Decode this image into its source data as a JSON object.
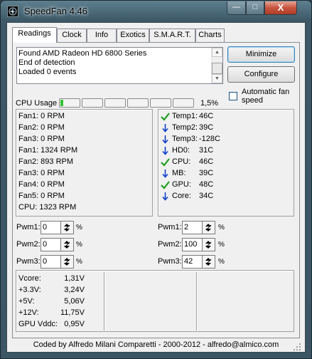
{
  "window": {
    "title": "SpeedFan 4.46",
    "caption_buttons": {
      "minimize": "—",
      "maximize": "□",
      "close": "X"
    }
  },
  "tabs": [
    {
      "label": "Readings",
      "active": true
    },
    {
      "label": "Clock",
      "active": false
    },
    {
      "label": "Info",
      "active": false
    },
    {
      "label": "Exotics",
      "active": false
    },
    {
      "label": "S.M.A.R.T.",
      "active": false
    },
    {
      "label": "Charts",
      "active": false
    }
  ],
  "log": {
    "lines": [
      "Found AMD Radeon HD 6800 Series",
      "End of detection",
      "Loaded 0 events"
    ]
  },
  "buttons": {
    "minimize": "Minimize",
    "configure": "Configure"
  },
  "auto_fan_speed": {
    "label_line1": "Automatic fan",
    "label_line2": "speed",
    "checked": false
  },
  "cpu_usage": {
    "label": "CPU Usage",
    "percent_text": "1,5%",
    "segments": [
      0.15,
      0,
      0,
      0,
      0,
      0
    ]
  },
  "fans": [
    "Fan1: 0 RPM",
    "Fan2: 0 RPM",
    "Fan3: 0 RPM",
    "Fan1: 1324 RPM",
    "Fan2: 893 RPM",
    "Fan3: 0 RPM",
    "Fan4: 0 RPM",
    "Fan5: 0 RPM",
    "CPU:  1323 RPM"
  ],
  "temps": [
    {
      "icon": "check-icon",
      "label": "Temp1:",
      "value": "46C"
    },
    {
      "icon": "arrow-down-icon",
      "label": "Temp2:",
      "value": "39C"
    },
    {
      "icon": "arrow-down-icon",
      "label": "Temp3:",
      "value": "-128C"
    },
    {
      "icon": "arrow-down-icon",
      "label": "HD0:",
      "value": "31C"
    },
    {
      "icon": "check-icon",
      "label": "CPU:",
      "value": "46C"
    },
    {
      "icon": "arrow-down-icon",
      "label": "MB:",
      "value": "39C"
    },
    {
      "icon": "check-icon",
      "label": "GPU:",
      "value": "48C"
    },
    {
      "icon": "arrow-down-icon",
      "label": "Core:",
      "value": "34C"
    }
  ],
  "pwm": {
    "left": [
      {
        "label": "Pwm1:",
        "value": "0",
        "unit": "%"
      },
      {
        "label": "Pwm2:",
        "value": "0",
        "unit": "%"
      },
      {
        "label": "Pwm3:",
        "value": "0",
        "unit": "%"
      }
    ],
    "right": [
      {
        "label": "Pwm1:",
        "value": "2",
        "unit": "%"
      },
      {
        "label": "Pwm2:",
        "value": "100",
        "unit": "%"
      },
      {
        "label": "Pwm3:",
        "value": "42",
        "unit": "%"
      }
    ]
  },
  "voltages": [
    {
      "label": "Vcore:",
      "value": "1,31V"
    },
    {
      "label": "+3.3V:",
      "value": "3,24V"
    },
    {
      "label": "+5V:",
      "value": "5,06V"
    },
    {
      "label": "+12V:",
      "value": "11,75V"
    },
    {
      "label": "GPU Vddc:",
      "value": "0,95V"
    }
  ],
  "status": {
    "text": "Coded by Alfredo Milani Comparetti - 2000-2012 - alfredo@almico.com"
  },
  "colors": {
    "accent_green": "#1f9d1f",
    "accent_blue": "#1040c8",
    "cpu_fill": "#34c234"
  }
}
